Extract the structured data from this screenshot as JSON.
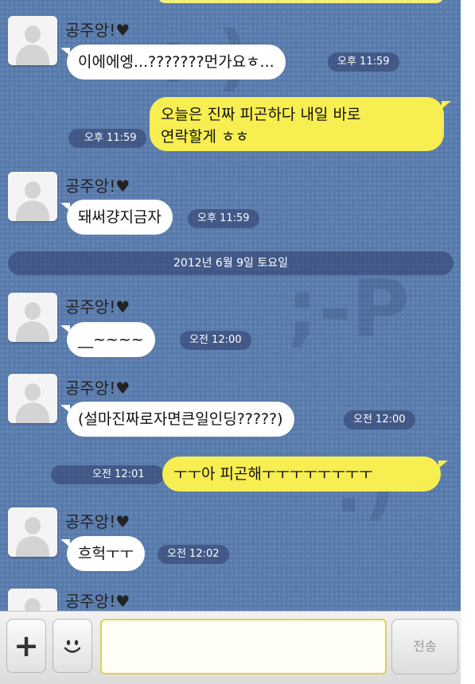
{
  "chat": {
    "sender_name": "공주앙!♥",
    "date_divider": "2012년 6월 9일 토요일",
    "messages": [
      {
        "text": "이에에엥...???????먼가요ㅎ...",
        "time": "오후 11:59"
      },
      {
        "line1": "오늘은 진짜 피곤하다 내일 바로",
        "line2": "연락할게 ㅎㅎ",
        "time": "오후 11:59"
      },
      {
        "text": "돼써걍지금자",
        "time": "오후 11:59"
      },
      {
        "text": "__~~~~",
        "time": "오전 12:00"
      },
      {
        "text": "(설마진짜로자면큰일인딩?????)",
        "time": "오전 12:00"
      },
      {
        "text": "ㅜㅜ아 피곤해ㅜㅜㅜㅜㅜㅜㅜㅜ",
        "time": "오전 12:01"
      },
      {
        "text": "흐헉ㅜㅜ",
        "time": "오전 12:02"
      }
    ]
  },
  "input_bar": {
    "plus_label": "+",
    "input_value": "",
    "send_label": "전송"
  },
  "colors": {
    "background": "#5b7dae",
    "outgoing_bubble": "#f7ef52",
    "incoming_bubble": "#ffffff"
  }
}
